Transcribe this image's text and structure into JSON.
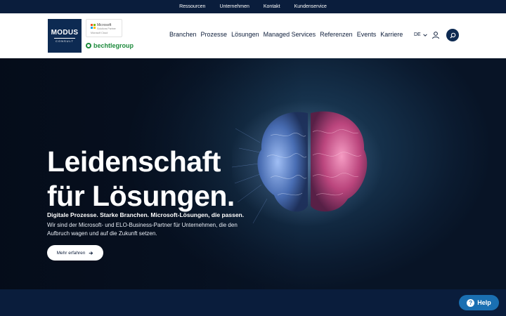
{
  "topbar": {
    "links": [
      "Ressourcen",
      "Unternehmen",
      "Kontakt",
      "Kundenservice"
    ]
  },
  "header": {
    "logo": {
      "line1": "MODUS",
      "line2": "CONSULT"
    },
    "ms_badge": {
      "line1": "Microsoft",
      "line2": "Solutions Partner",
      "line3": "Microsoft Cloud"
    },
    "bechtle": "bechtlegroup",
    "nav": [
      "Branchen",
      "Prozesse",
      "Lösungen",
      "Managed Services",
      "Referenzen",
      "Events",
      "Karriere"
    ],
    "lang": "DE"
  },
  "hero": {
    "title_line1": "Leidenschaft",
    "title_line2": "für Lösungen.",
    "subtitle": "Digitale Prozesse. Starke Branchen. Microsoft-Lösungen, die passen.",
    "description": "Wir sind der Microsoft- und ELO-Business-Partner für Unternehmen, die den Aufbruch wagen und auf die Zukunft setzen.",
    "cta_label": "Mehr erfahren"
  },
  "help": {
    "label": "Help"
  },
  "colors": {
    "navy": "#0a1d3c",
    "brand_blue": "#0d2a52",
    "bechtle_green": "#1d8a3c",
    "help_blue": "#1a6fb2"
  }
}
